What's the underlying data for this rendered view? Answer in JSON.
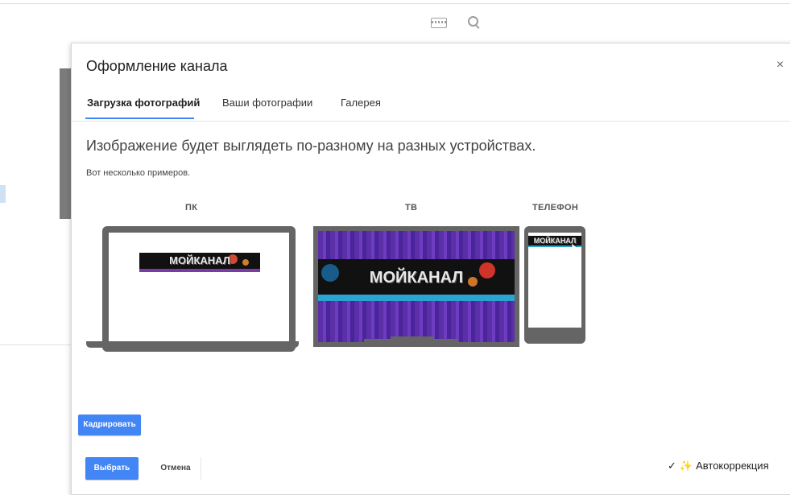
{
  "dialog": {
    "title": "Оформление канала",
    "close_label": "×"
  },
  "tabs": [
    {
      "label": "Загрузка фотографий",
      "active": true
    },
    {
      "label": "Ваши фотографии",
      "active": false
    },
    {
      "label": "Галерея",
      "active": false
    }
  ],
  "content": {
    "heading": "Изображение будет выглядеть по-разному на разных устройствах.",
    "subheading": "Вот несколько примеров."
  },
  "devices": {
    "pc_label": "ПК",
    "tv_label": "ТВ",
    "phone_label": "ТЕЛЕФОН"
  },
  "banner": {
    "text": "МОЙКАНАЛ"
  },
  "buttons": {
    "crop": "Кадрировать",
    "select": "Выбрать",
    "cancel": "Отмена"
  },
  "autocorrect": {
    "label": "Автокоррекция",
    "check_icon": "✓",
    "wand_icon": "✨"
  },
  "colors": {
    "accent": "#4285f4",
    "device_gray": "#656565",
    "tv_purple": "#5a2fa8"
  }
}
